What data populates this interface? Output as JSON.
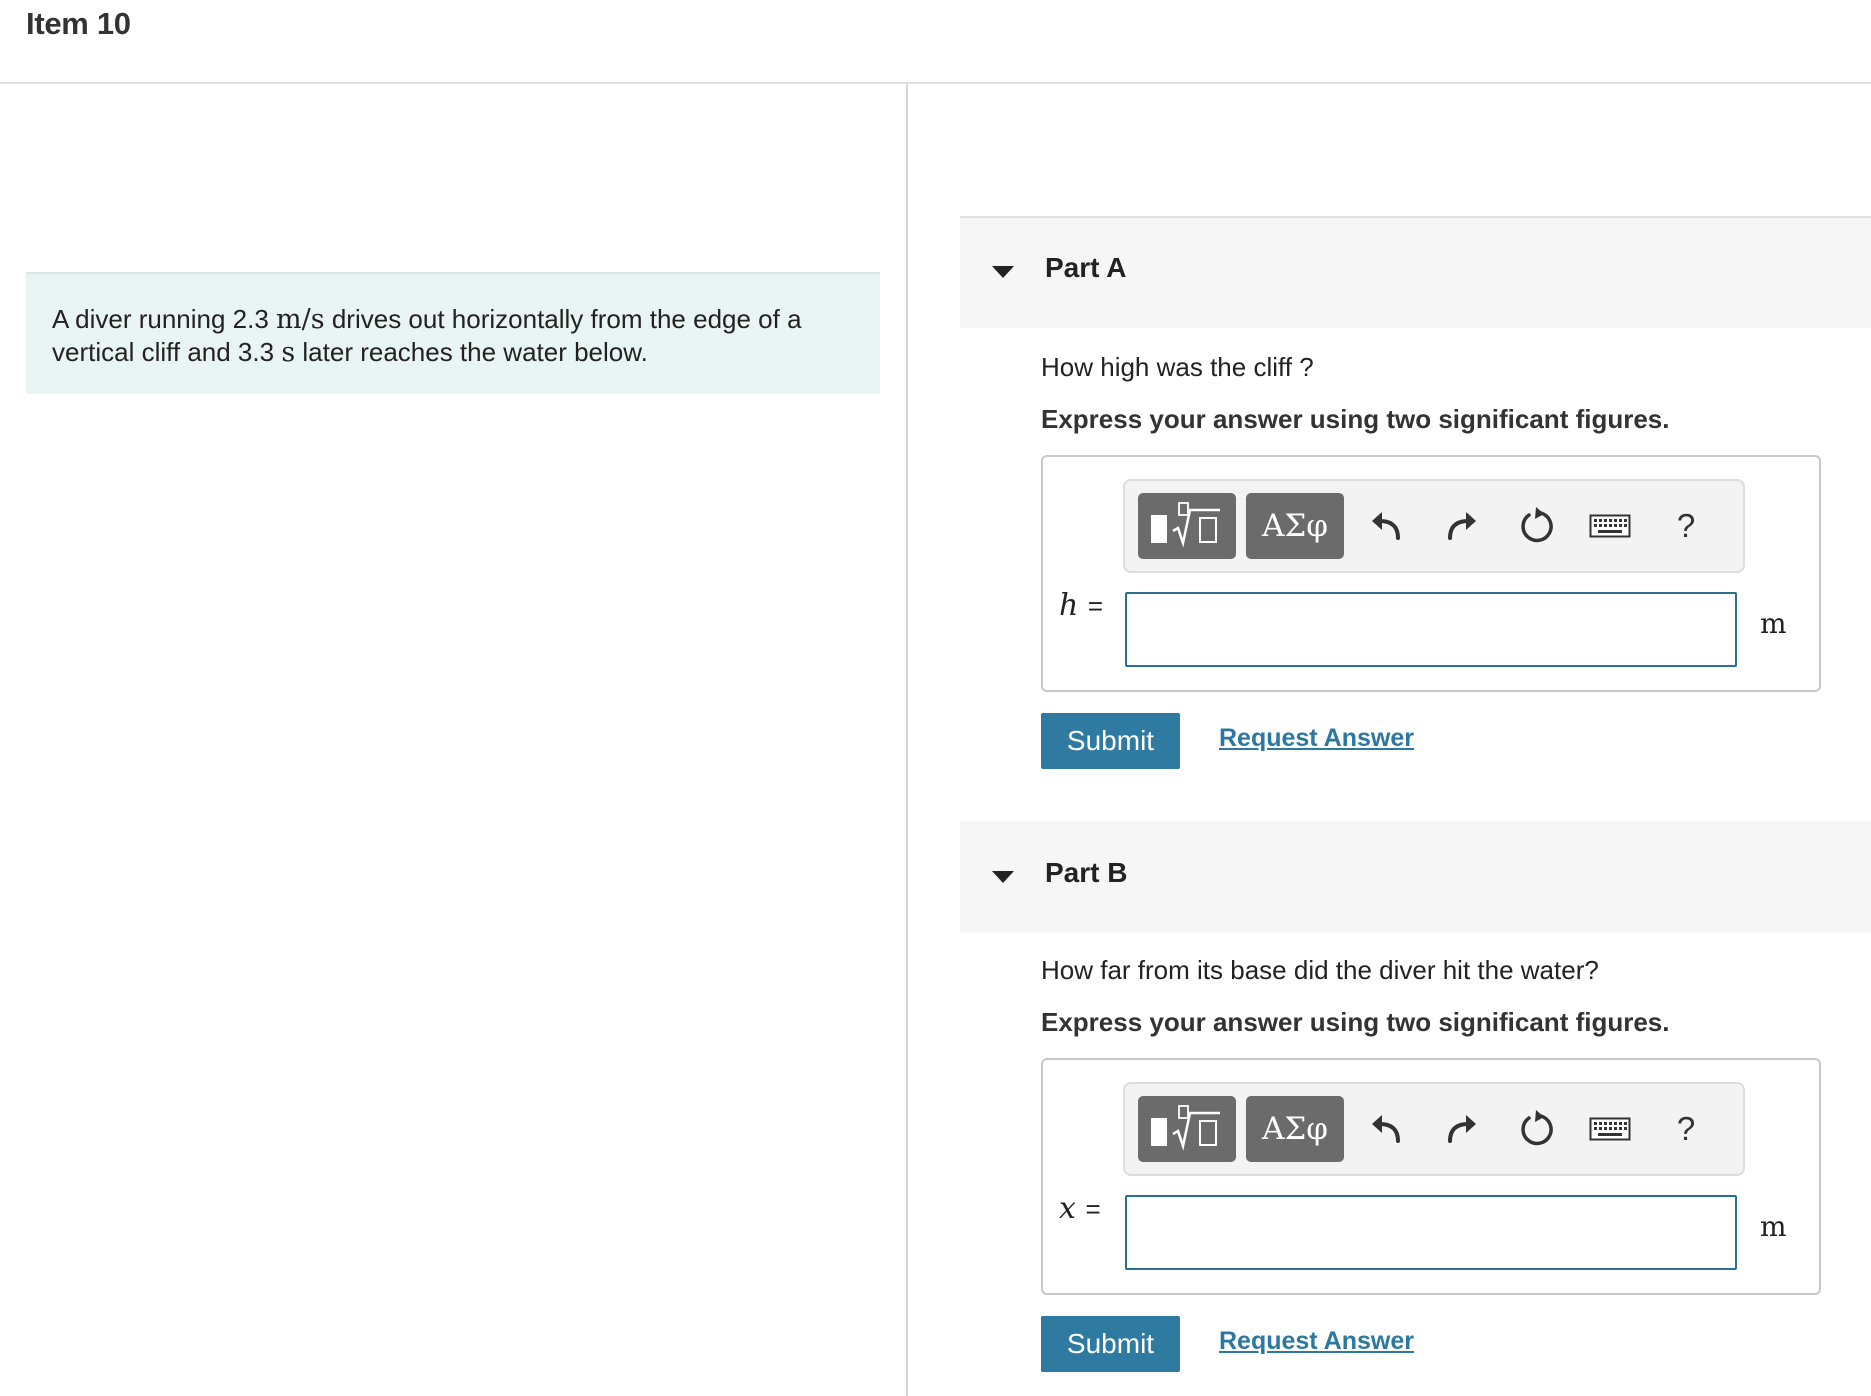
{
  "item": {
    "title": "Item 10"
  },
  "problem": {
    "text_1": "A diver running 2.3 ",
    "unit_speed_num": "m",
    "unit_speed_sep": "/",
    "unit_speed_den": "s",
    "text_2": " drives out horizontally from the edge of a vertical cliff and 3.3 ",
    "unit_time": "s",
    "text_3": " later reaches the water below."
  },
  "toolbar": {
    "templates_icon": "templates-icon",
    "symbols_label": "ΑΣφ",
    "undo_icon": "undo-icon",
    "redo_icon": "redo-icon",
    "reset_icon": "reset-icon",
    "keyboard_icon": "keyboard-icon",
    "help_label": "?"
  },
  "colors": {
    "accent": "#2f7aa0",
    "link": "#2c78a0",
    "problem_bg": "#e9f5f4",
    "toolbar_button": "#6b6b6b",
    "input_border": "#2b6f93"
  },
  "parts": [
    {
      "title": "Part A",
      "question": "How high was the cliff ?",
      "instruction": "Express your answer using two significant figures.",
      "variable": "h",
      "equals": "=",
      "unit": "m",
      "value": "",
      "submit_label": "Submit",
      "request_label": "Request Answer"
    },
    {
      "title": "Part B",
      "question": "How far from its base did the diver hit the water?",
      "instruction": "Express your answer using two significant figures.",
      "variable": "x",
      "equals": "=",
      "unit": "m",
      "value": "",
      "submit_label": "Submit",
      "request_label": "Request Answer"
    }
  ]
}
